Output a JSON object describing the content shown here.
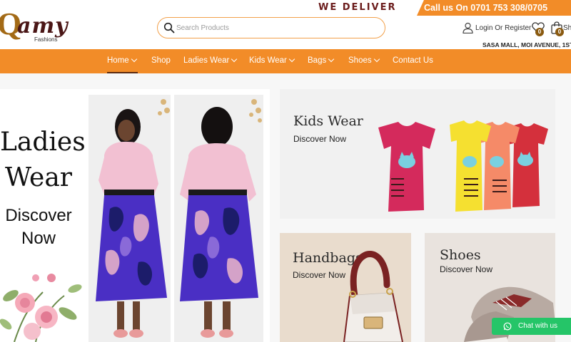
{
  "brand": {
    "logo_mark": "Q",
    "logo_text": "amy",
    "logo_sub": "Fashions"
  },
  "topbar": {
    "deliver": "WE DELIVER",
    "call": "Call us On 0701 753 308/0705"
  },
  "search": {
    "placeholder": "Search Products",
    "value": ""
  },
  "account": {
    "login_label": "Login Or Register",
    "wishlist_count": "0",
    "cart_count": "0",
    "shop_label_cut": "Sh",
    "address": "SASA MALL, MOI AVENUE, 1ST"
  },
  "nav": {
    "items": [
      {
        "label": "Home",
        "dropdown": true,
        "active": true
      },
      {
        "label": "Shop",
        "dropdown": false
      },
      {
        "label": "Ladies Wear",
        "dropdown": true
      },
      {
        "label": "Kids Wear",
        "dropdown": true
      },
      {
        "label": "Bags",
        "dropdown": true
      },
      {
        "label": "Shoes",
        "dropdown": true
      },
      {
        "label": "Contact Us",
        "dropdown": false
      }
    ]
  },
  "banners": {
    "ladies": {
      "title_line1": "Ladies",
      "title_line2": "Wear",
      "cta_line1": "Discover",
      "cta_line2": "Now"
    },
    "kids": {
      "title": "Kids Wear",
      "cta": "Discover Now"
    },
    "handbags": {
      "title": "Handbags",
      "cta": "Discover Now"
    },
    "shoes": {
      "title": "Shoes",
      "cta": "Discover Now"
    }
  },
  "chat": {
    "label": "Chat with us"
  },
  "colors": {
    "accent": "#f28c28",
    "brand_dark": "#4a1616",
    "brand_gold": "#a36a16",
    "chat_green": "#25c568",
    "dress_blue": "#4a2fc4",
    "top_pink": "#f2c0d2"
  },
  "icons": [
    "search-icon",
    "user-icon",
    "heart-icon",
    "bag-icon",
    "whatsapp-icon",
    "chevron-down-icon"
  ]
}
